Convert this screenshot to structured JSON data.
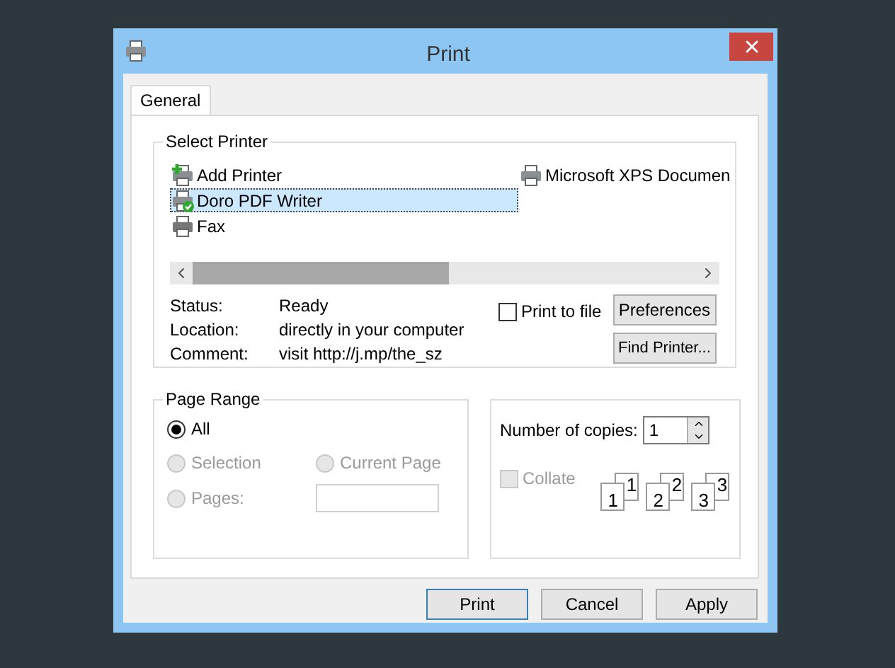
{
  "window": {
    "title": "Print"
  },
  "tabs": [
    {
      "label": "General",
      "selected": true
    }
  ],
  "select_printer": {
    "title": "Select Printer",
    "printers": [
      {
        "name": "Add Printer",
        "kind": "add",
        "selected": false
      },
      {
        "name": "Doro PDF Writer",
        "kind": "default",
        "selected": true
      },
      {
        "name": "Fax",
        "kind": "fax",
        "selected": false
      },
      {
        "name": "Microsoft XPS Documen",
        "kind": "printer",
        "selected": false
      }
    ],
    "info": [
      {
        "label": "Status:",
        "value": "Ready"
      },
      {
        "label": "Location:",
        "value": "directly in your computer"
      },
      {
        "label": "Comment:",
        "value": "visit http://j.mp/the_sz"
      }
    ],
    "print_to_file": {
      "label": "Print to file",
      "checked": false
    },
    "buttons": [
      "Preferences",
      "Find Printer..."
    ]
  },
  "page_range": {
    "title": "Page Range",
    "options": [
      {
        "label": "All",
        "selected": true,
        "disabled": false
      },
      {
        "label": "Selection",
        "selected": false,
        "disabled": true
      },
      {
        "label": "Current Page",
        "selected": false,
        "disabled": true
      },
      {
        "label": "Pages:",
        "selected": false,
        "disabled": true
      }
    ],
    "pages_field": {
      "disabled": true
    }
  },
  "copies": {
    "label": "Number of copies:",
    "value": "1",
    "collate": {
      "label": "Collate",
      "checked": false,
      "disabled": true
    },
    "collate_pages": [
      {
        "front": "1",
        "back": "1"
      },
      {
        "front": "2",
        "back": "2"
      },
      {
        "front": "3",
        "back": "3"
      }
    ]
  },
  "buttons": [
    {
      "label": "Print",
      "default": true
    },
    {
      "label": "Cancel",
      "default": false
    },
    {
      "label": "Apply",
      "default": false
    }
  ]
}
